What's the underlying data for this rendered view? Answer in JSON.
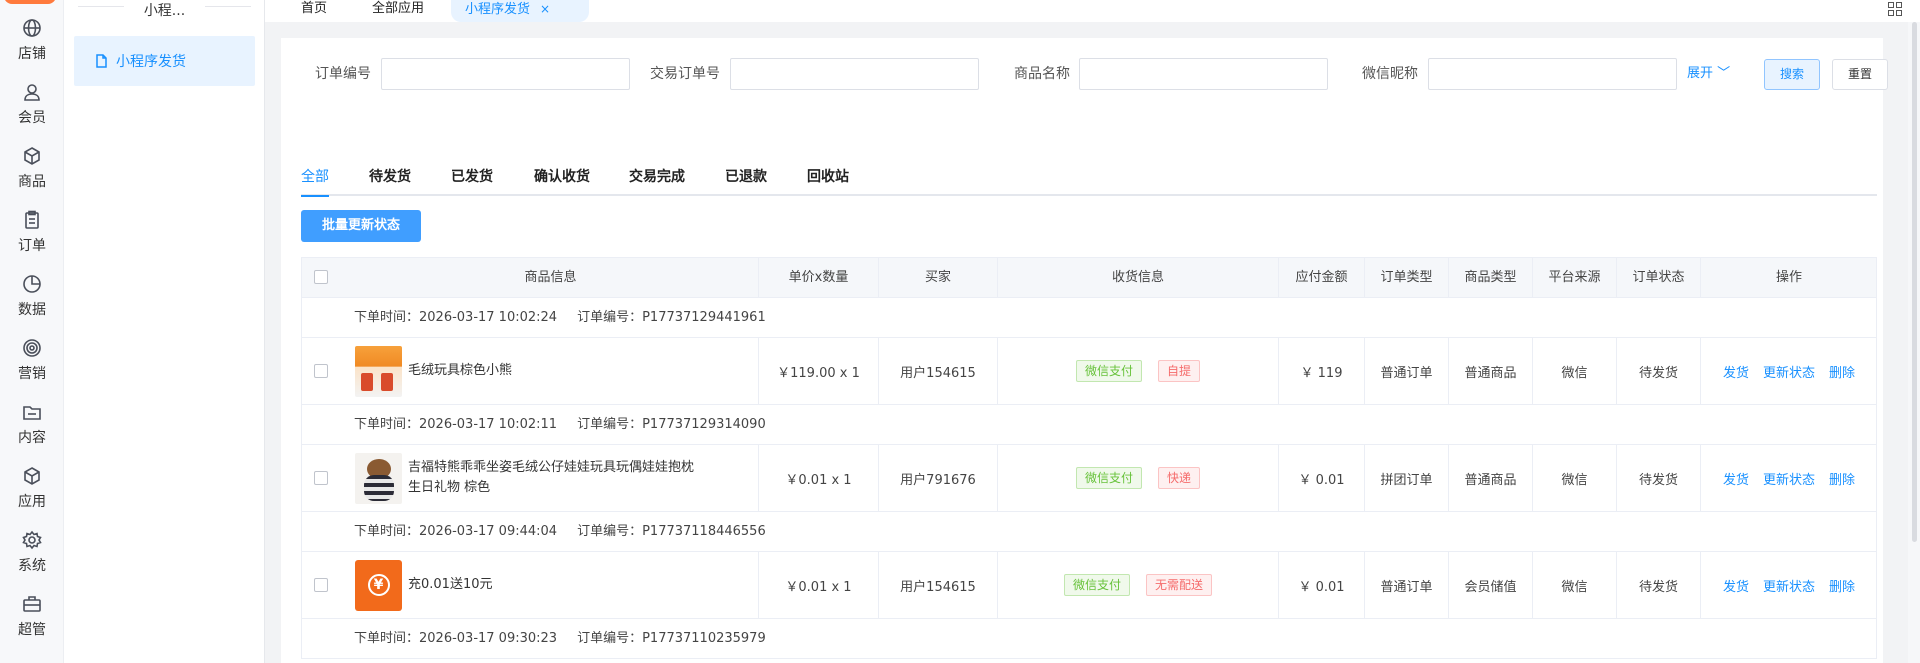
{
  "rail": {
    "items": [
      {
        "label": "店铺",
        "icon": "globe-icon"
      },
      {
        "label": "会员",
        "icon": "user-icon"
      },
      {
        "label": "商品",
        "icon": "box-icon"
      },
      {
        "label": "订单",
        "icon": "clipboard-icon"
      },
      {
        "label": "数据",
        "icon": "pie-chart-icon"
      },
      {
        "label": "营销",
        "icon": "target-icon"
      },
      {
        "label": "内容",
        "icon": "folder-icon"
      },
      {
        "label": "应用",
        "icon": "cube-icon"
      },
      {
        "label": "系统",
        "icon": "gear-icon"
      },
      {
        "label": "超管",
        "icon": "briefcase-icon"
      }
    ]
  },
  "subnav": {
    "title": "小程...",
    "item": "小程序发货"
  },
  "top_tabs": [
    {
      "label": "首页"
    },
    {
      "label": "全部应用"
    },
    {
      "label": "小程序发货",
      "close": "×"
    }
  ],
  "filters": {
    "order_no": "订单编号",
    "trade_no": "交易订单号",
    "product_name": "商品名称",
    "wechat_nick": "微信昵称",
    "expand": "展开 ﹀",
    "search": "搜索",
    "reset": "重置"
  },
  "status_tabs": [
    "全部",
    "待发货",
    "已发货",
    "确认收货",
    "交易完成",
    "已退款",
    "回收站"
  ],
  "batch_button": "批量更新状态",
  "table": {
    "headers": [
      "商品信息",
      "单价x数量",
      "买家",
      "收货信息",
      "应付金额",
      "订单类型",
      "商品类型",
      "平台来源",
      "订单状态",
      "操作"
    ],
    "orders": [
      {
        "time": "下单时间：2026-03-17 10:02:24",
        "no": "订单编号：P17737129441961",
        "product": "毛绒玩具棕色小熊",
        "price_qty": "￥119.00 x 1",
        "buyer": "用户154615",
        "pay_tag": "微信支付",
        "ship_tag": "自提",
        "amount": "￥ 119",
        "order_type": "普通订单",
        "product_type": "普通商品",
        "platform": "微信",
        "status": "待发货"
      },
      {
        "time": "下单时间：2026-03-17 10:02:11",
        "no": "订单编号：P17737129314090",
        "product": "吉福特熊乖乖坐姿毛绒公仔娃娃玩具玩偶娃娃抱枕生日礼物 棕色",
        "price_qty": "￥0.01 x 1",
        "buyer": "用户791676",
        "pay_tag": "微信支付",
        "ship_tag": "快递",
        "amount": "￥ 0.01",
        "order_type": "拼团订单",
        "product_type": "普通商品",
        "platform": "微信",
        "status": "待发货"
      },
      {
        "time": "下单时间：2026-03-17 09:44:04",
        "no": "订单编号：P17737118446556",
        "product": "充0.01送10元",
        "price_qty": "￥0.01 x 1",
        "buyer": "用户154615",
        "pay_tag": "微信支付",
        "ship_tag": "无需配送",
        "amount": "￥ 0.01",
        "order_type": "普通订单",
        "product_type": "会员储值",
        "platform": "微信",
        "status": "待发货"
      },
      {
        "time": "下单时间：2026-03-17 09:30:23",
        "no": "订单编号：P17737110235979"
      }
    ],
    "actions": {
      "ship": "发货",
      "update": "更新状态",
      "delete": "删除"
    }
  }
}
